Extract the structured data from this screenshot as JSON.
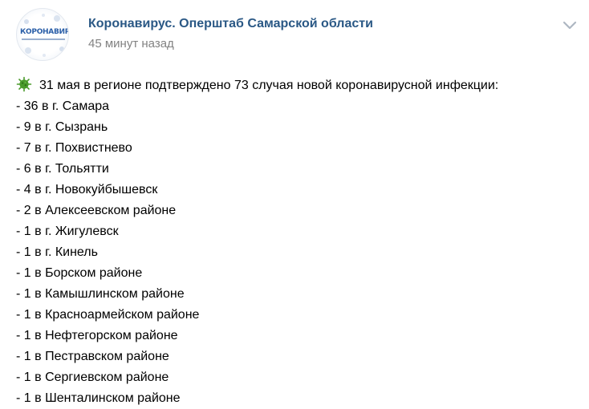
{
  "post": {
    "group_name": "Коронавирус. Оперштаб Самарской области",
    "time": "45 минут назад",
    "avatar_text": "КОРОНАВИРУС",
    "menu_icon": "chevron-down-icon",
    "lead_icon": "virus-icon",
    "intro": "31 мая в регионе подтверждено 73 случая новой коронавирусной инфекции:",
    "lines": [
      "- 36 в г. Самара",
      "- 9 в г. Сызрань",
      "- 7 в г. Похвистнево",
      "- 6 в г. Тольятти",
      "- 4 в г. Новокуйбышевск",
      "- 2 в Алексеевском районе",
      "- 1 в г. Жигулевск",
      "- 1 в г. Кинель",
      "- 1 в Борском районе",
      "- 1 в Камышлинском районе",
      "- 1 в Красноармейском районе",
      "- 1 в Нефтегорском районе",
      "- 1 в Пестравском районе",
      "- 1 в Сергиевском районе",
      "- 1 в Шенталинском районе"
    ]
  },
  "colors": {
    "group_link": "#2a5885",
    "timestamp": "#828282",
    "virus_icon": "#4a9a2a",
    "chevron": "#aeb7c2"
  }
}
